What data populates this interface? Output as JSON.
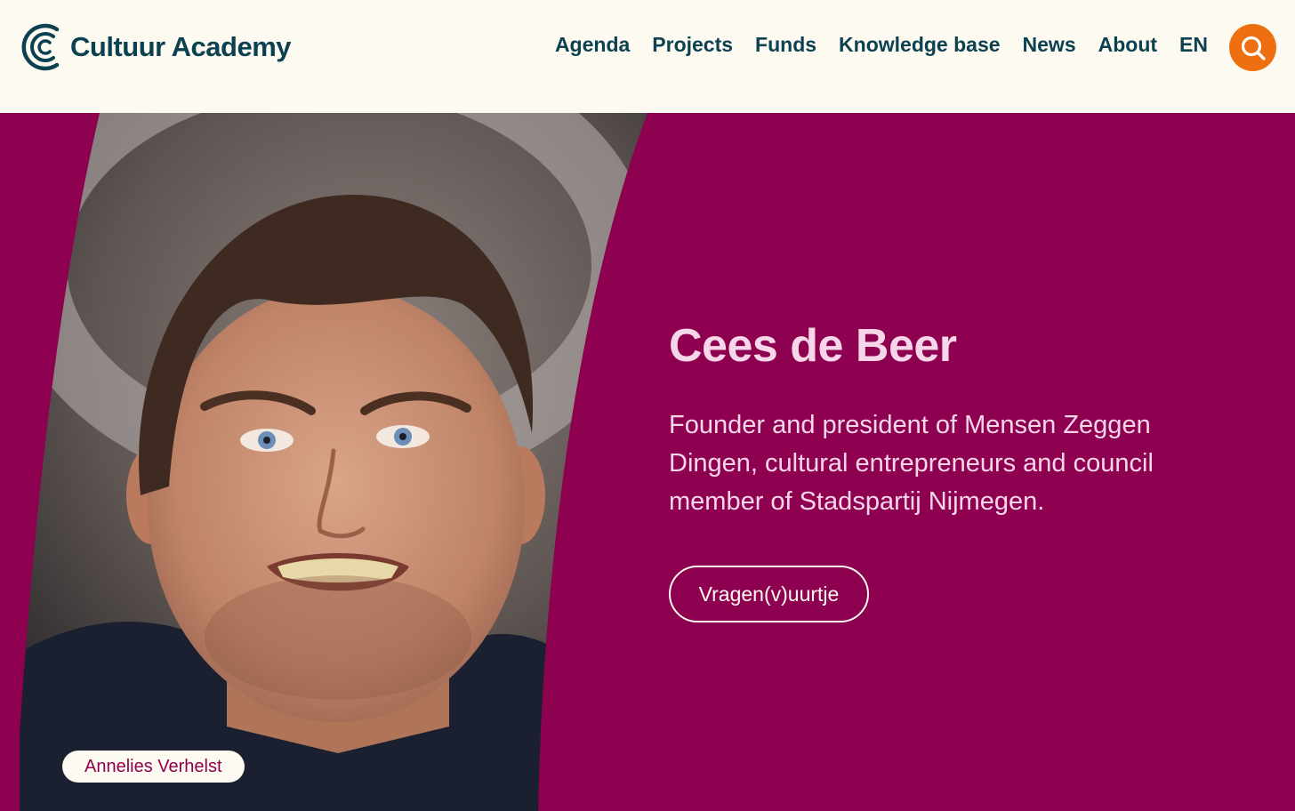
{
  "header": {
    "logo_icon": "cultuur-academy-logo-icon",
    "brand": "Cultuur Academy",
    "nav": [
      {
        "label": "Agenda"
      },
      {
        "label": "Projects"
      },
      {
        "label": "Funds"
      },
      {
        "label": "Knowledge base"
      },
      {
        "label": "News"
      },
      {
        "label": "About"
      },
      {
        "label": "EN"
      }
    ],
    "search_icon": "search-icon"
  },
  "hero": {
    "name": "Cees de Beer",
    "description": "Founder and president of Mensen Zeggen Dingen, cultural entrepreneurs and council member of Stadspartij Nijmegen.",
    "button_label": "Vragen(v)uurtje",
    "photo_credit": "Annelies Verhelst"
  },
  "colors": {
    "header_bg": "#FDFAF1",
    "brand_text": "#0B4150",
    "accent_orange": "#EE6F10",
    "hero_bg": "#8E0050",
    "hero_text": "#F7D6EA"
  }
}
